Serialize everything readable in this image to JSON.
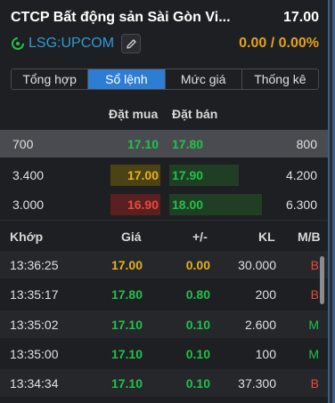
{
  "header": {
    "company_name": "CTCP Bất động sản Sài Gòn Vi...",
    "price": "17.00",
    "symbol": "LSG:UPCOM",
    "change": "0.00 / 0.00%"
  },
  "tabs": [
    {
      "label": "Tổng hợp",
      "active": false
    },
    {
      "label": "Sổ lệnh",
      "active": true
    },
    {
      "label": "Mức giá",
      "active": false
    },
    {
      "label": "Thống kê",
      "active": false
    }
  ],
  "order_book": {
    "bid_header": "Đặt mua",
    "ask_header": "Đặt bán",
    "rows": [
      {
        "bid_vol": "700",
        "bid": "17.10",
        "ask": "17.80",
        "ask_vol": "800"
      },
      {
        "bid_vol": "3.400",
        "bid": "17.00",
        "ask": "17.90",
        "ask_vol": "4.200"
      },
      {
        "bid_vol": "3.000",
        "bid": "16.90",
        "ask": "18.00",
        "ask_vol": "6.300"
      }
    ]
  },
  "trades": {
    "headers": {
      "time": "Khớp",
      "price": "Giá",
      "change": "+/-",
      "volume": "KL",
      "side": "M/B"
    },
    "rows": [
      {
        "time": "13:36:25",
        "price": "17.00",
        "change": "0.00",
        "volume": "30.000",
        "side": "B"
      },
      {
        "time": "13:35:17",
        "price": "17.80",
        "change": "0.80",
        "volume": "200",
        "side": "B"
      },
      {
        "time": "13:35:02",
        "price": "17.10",
        "change": "0.10",
        "volume": "2.600",
        "side": "M"
      },
      {
        "time": "13:35:00",
        "price": "17.10",
        "change": "0.10",
        "volume": "100",
        "side": "M"
      },
      {
        "time": "13:34:34",
        "price": "17.10",
        "change": "0.10",
        "volume": "37.300",
        "side": "B"
      }
    ]
  },
  "colors": {
    "accent": "#2d7dd2",
    "symbol": "#2e9bd6",
    "reference": "#e5b21c",
    "up": "#1fc24a",
    "down": "#e74c3c"
  },
  "icons": {
    "symbol": "refresh-circle-icon",
    "edit": "pencil-icon"
  }
}
